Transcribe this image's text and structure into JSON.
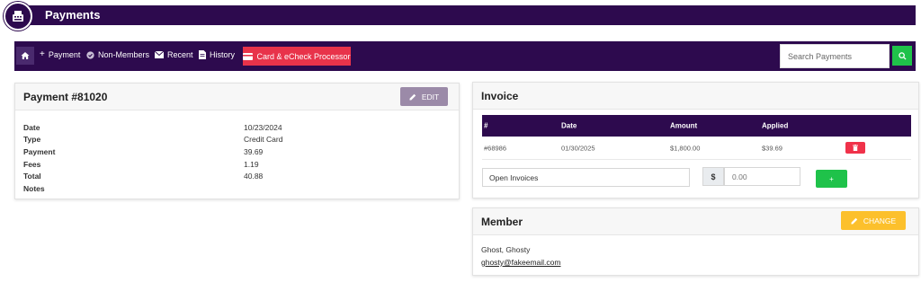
{
  "header": {
    "title": "Payments",
    "logo_icon": "cash-register-icon"
  },
  "toolbar": {
    "home_icon": "home-icon",
    "items": [
      {
        "icon": "plus-icon",
        "label": "Payment"
      },
      {
        "icon": "check-circle-icon",
        "label": "Non-Members"
      },
      {
        "icon": "envelope-icon",
        "label": "Recent"
      },
      {
        "icon": "document-icon",
        "label": "History"
      }
    ],
    "card_processor_label": "Card & eCheck Processor",
    "search_placeholder": "Search Payments",
    "colors": {
      "bar": "#2d0a4e",
      "card_btn": "#e8334a",
      "search_btn": "#1fc24a"
    }
  },
  "payment": {
    "title": "Payment #81020",
    "edit_label": "EDIT",
    "fields": [
      {
        "label": "Date",
        "value": "10/23/2024"
      },
      {
        "label": "Type",
        "value": "Credit Card"
      },
      {
        "label": "Payment",
        "value": "39.69"
      },
      {
        "label": "Fees",
        "value": "1.19"
      },
      {
        "label": "Total",
        "value": "40.88"
      },
      {
        "label": "Notes",
        "value": ""
      }
    ]
  },
  "invoice": {
    "title": "Invoice",
    "columns": [
      "#",
      "Date",
      "Amount",
      "Applied"
    ],
    "rows": [
      {
        "number": "#68986",
        "date": "01/30/2025",
        "amount": "$1,800.00",
        "applied": "$39.69"
      }
    ],
    "open_invoices_label": "Open Invoices",
    "currency_symbol": "$",
    "amount_placeholder": "0.00",
    "add_label": "+"
  },
  "member": {
    "title": "Member",
    "change_label": "CHANGE",
    "name": "Ghost, Ghosty",
    "email": "ghosty@fakeemail.com"
  }
}
